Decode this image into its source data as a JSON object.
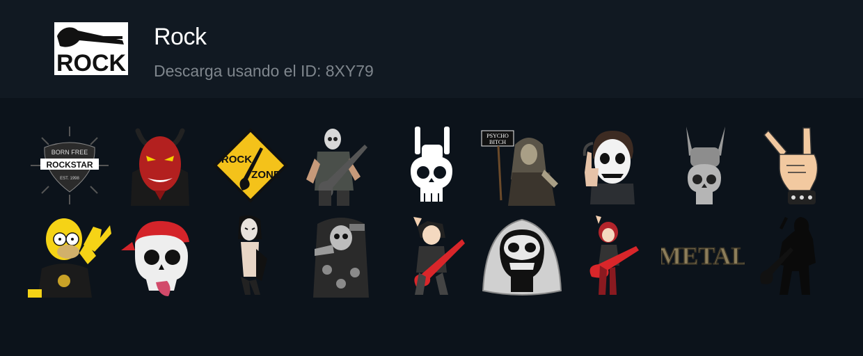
{
  "pack": {
    "title": "Rock",
    "subtitle": "Descarga usando el ID: 8XY79",
    "logo_text": "ROCK"
  },
  "stickers": [
    {
      "name": "rockstar-pick",
      "text": [
        "BORN FREE",
        "ROCKSTAR",
        "EST. 1998"
      ]
    },
    {
      "name": "red-devil",
      "text": []
    },
    {
      "name": "rock-zone-sign",
      "text": [
        "ROCK",
        "ZONE"
      ]
    },
    {
      "name": "metal-guitarist",
      "text": []
    },
    {
      "name": "skeleton-horns-skull",
      "text": []
    },
    {
      "name": "psycho-bitch-zombie",
      "text": [
        "PSYCHO",
        "BITCH"
      ]
    },
    {
      "name": "face-paint-kid",
      "text": []
    },
    {
      "name": "skull-horns-hand",
      "text": []
    },
    {
      "name": "rock-hand",
      "text": []
    },
    {
      "name": "homer-rock",
      "text": []
    },
    {
      "name": "skull-red-bandana",
      "text": []
    },
    {
      "name": "goth-singer",
      "text": []
    },
    {
      "name": "grim-reaper-gunslinger",
      "text": []
    },
    {
      "name": "anime-guitarist",
      "text": []
    },
    {
      "name": "hooded-skull",
      "text": []
    },
    {
      "name": "anime-girl-guitar",
      "text": []
    },
    {
      "name": "metal-lettering",
      "text": [
        "METAL"
      ]
    },
    {
      "name": "guitarist-silhouette",
      "text": []
    }
  ],
  "colors": {
    "header_bg": "#111922",
    "page_bg": "#0c131b",
    "title": "#ffffff",
    "subtitle": "#7f868d"
  }
}
